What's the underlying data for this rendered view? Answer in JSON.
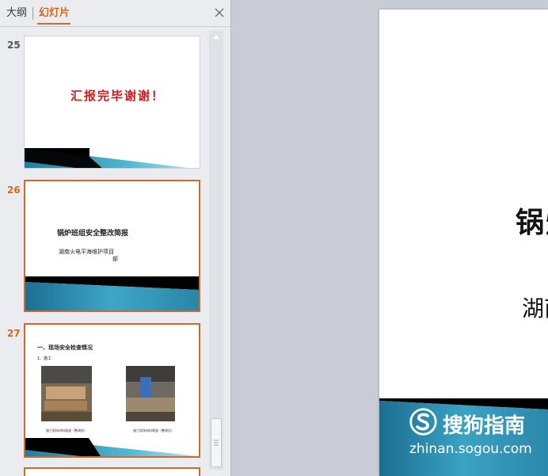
{
  "tabs": {
    "outline": "大纲",
    "slides": "幻灯片"
  },
  "slides": [
    {
      "number": "25",
      "text": "汇报完毕谢谢！"
    },
    {
      "number": "26",
      "title": "锅炉班组安全整改简报",
      "subtitle_line1": "湖南火电平海维护项目",
      "subtitle_line2": "部"
    },
    {
      "number": "27",
      "heading": "一、现场安全检查情况",
      "subheading": "1、施工",
      "caption_left": "施工现场材料堆放（整改前）",
      "caption_right": "施工现场材料堆放（整改后）"
    }
  ],
  "main_slide": {
    "title_partial": "锅炉",
    "subtitle_partial": "湖南"
  },
  "watermark": {
    "brand": "搜狗指南",
    "url": "zhinan.sogou.com"
  },
  "colors": {
    "accent": "#d2691e",
    "slide_teal": "#2a8fae",
    "title_red": "#c81e1e"
  }
}
